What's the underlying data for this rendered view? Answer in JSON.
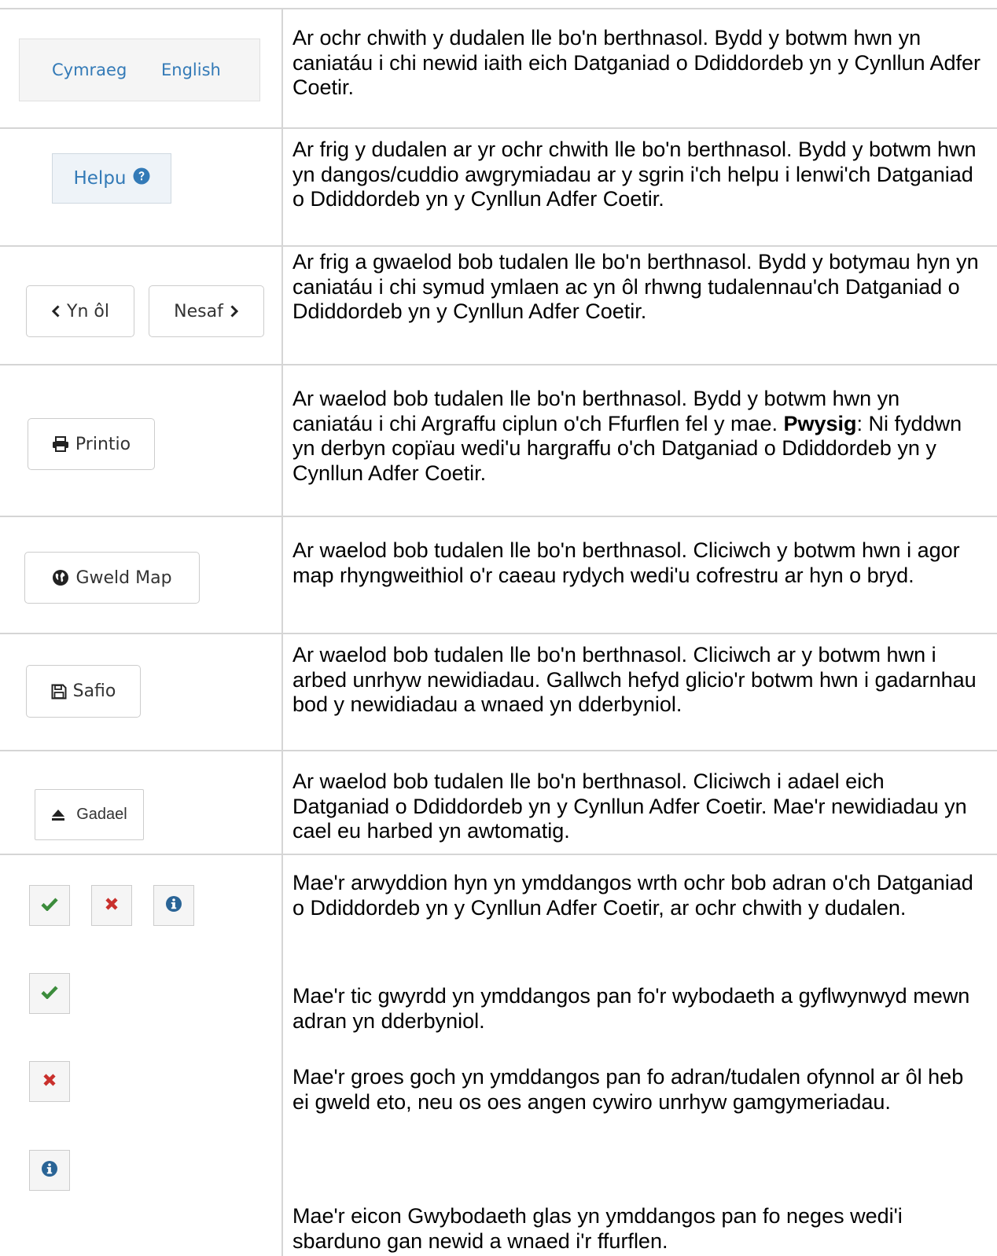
{
  "rows": [
    {
      "buttons": {
        "cymraeg": "Cymraeg",
        "english": "English"
      },
      "description": "Ar ochr chwith y dudalen lle bo'n berthnasol. Bydd y botwm hwn yn caniatáu i chi newid iaith eich Datganiad o Ddiddordeb yn y Cynllun Adfer Coetir."
    },
    {
      "button": "Helpu",
      "description": "Ar frig y dudalen ar yr ochr chwith lle bo'n berthnasol. Bydd y botwm hwn yn dangos/cuddio awgrymiadau ar y sgrin i'ch helpu i lenwi'ch Datganiad o Ddiddordeb yn y Cynllun Adfer Coetir."
    },
    {
      "buttons": {
        "back": "Yn ôl",
        "next": "Nesaf"
      },
      "description": "Ar frig a gwaelod bob tudalen lle bo'n berthnasol. Bydd y botymau hyn yn caniatáu i chi symud ymlaen ac yn ôl rhwng tudalennau'ch Datganiad o Ddiddordeb yn y Cynllun Adfer Coetir."
    },
    {
      "button": "Printio",
      "description": "Ar waelod bob tudalen lle bo'n berthnasol. Bydd y botwm hwn yn caniatáu i chi Argraffu ciplun o'ch Ffurflen fel y mae.",
      "important_label": "Pwysig",
      "important_text": ": Ni fyddwn yn derbyn copïau wedi'u hargraffu o'ch Datganiad o Ddiddordeb yn y Cynllun Adfer Coetir."
    },
    {
      "button": "Gweld Map",
      "description": "Ar waelod bob tudalen lle bo'n berthnasol. Cliciwch y botwm hwn i agor map rhyngweithiol o'r caeau rydych wedi'u cofrestru ar hyn o bryd."
    },
    {
      "button": "Safio",
      "description": "Ar waelod bob tudalen lle bo'n berthnasol. Cliciwch ar y botwm hwn i arbed unrhyw newidiadau. Gallwch hefyd glicio'r botwm hwn i gadarnhau bod y newidiadau a wnaed yn dderbyniol."
    },
    {
      "button": "Gadael",
      "description": "Ar waelod bob tudalen lle bo'n berthnasol. Cliciwch i adael eich Datganiad o Ddiddordeb yn y Cynllun Adfer Coetir. Mae'r newidiadau yn cael eu harbed yn awtomatig."
    },
    {
      "description_intro": "Mae'r arwyddion hyn yn ymddangos wrth ochr bob adran o'ch Datganiad o Ddiddordeb yn y Cynllun Adfer Coetir, ar ochr chwith y dudalen.",
      "description_tick": "Mae'r tic gwyrdd yn ymddangos pan fo'r wybodaeth a gyflwynwyd mewn adran yn dderbyniol.",
      "description_cross": "Mae'r groes goch yn ymddangos pan fo adran/tudalen ofynnol ar ôl heb ei gweld eto, neu os oes angen cywiro unrhyw gamgymeriadau.",
      "description_info": "Mae'r eicon Gwybodaeth glas yn ymddangos pan fo neges wedi'i sbarduno gan newid a wnaed i'r ffurflen."
    }
  ],
  "colors": {
    "link_blue": "#337ab7",
    "tick_green": "#3c8c3c",
    "cross_red": "#c9302c",
    "info_blue": "#2a6496"
  },
  "icons": [
    "chevron-left-icon",
    "chevron-right-icon",
    "question-circle-icon",
    "print-icon",
    "globe-icon",
    "floppy-disk-icon",
    "eject-icon",
    "tick-icon",
    "cross-icon",
    "info-icon"
  ]
}
